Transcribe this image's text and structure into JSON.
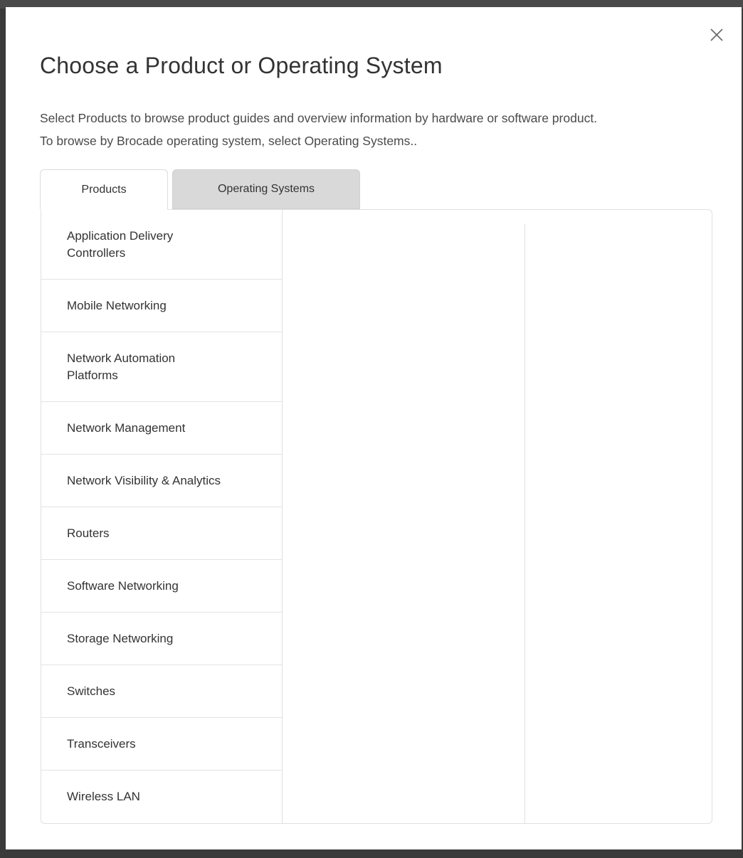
{
  "modal": {
    "title": "Choose a Product or Operating System",
    "description_line1": "Select Products to browse product guides and overview information by hardware or software product.",
    "description_line2": "To browse by Brocade operating system, select Operating Systems..",
    "close_icon": "close-icon"
  },
  "tabs": [
    {
      "label": "Products",
      "active": true
    },
    {
      "label": "Operating Systems",
      "active": false
    }
  ],
  "products": [
    "Application Delivery Controllers",
    "Mobile Networking",
    "Network Automation Platforms",
    "Network Management",
    "Network Visibility & Analytics",
    "Routers",
    "Software Networking",
    "Storage Networking",
    "Switches",
    "Transceivers",
    "Wireless LAN"
  ]
}
